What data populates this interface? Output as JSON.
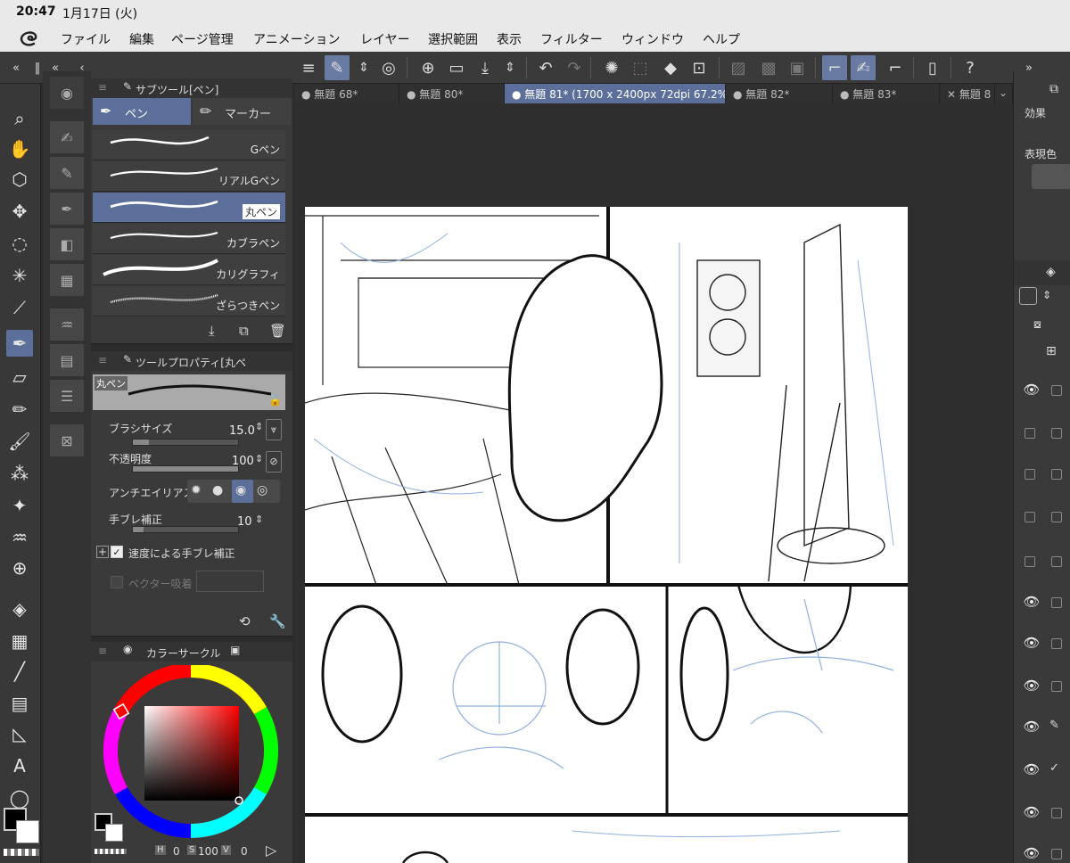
{
  "status": {
    "time": "20:47",
    "date": "1月17日 (火)"
  },
  "menu": [
    "ファイル",
    "編集",
    "ページ管理",
    "アニメーション",
    "レイヤー",
    "選択範囲",
    "表示",
    "フィルター",
    "ウィンドウ",
    "ヘルプ"
  ],
  "tabs": [
    {
      "label": "● 無題 68*"
    },
    {
      "label": "● 無題 80*"
    },
    {
      "label": "● 無題 81* (1700 x 2400px 72dpi 67.2%)"
    },
    {
      "label": "● 無題 82*"
    },
    {
      "label": "● 無題 83*"
    },
    {
      "label": "✕ 無題 8"
    }
  ],
  "subtool_panel": {
    "title": "サブツール[ペン]",
    "tabs": [
      "ペン",
      "マーカー"
    ],
    "brushes": [
      "Gペン",
      "リアルGペン",
      "丸ペン",
      "カブラペン",
      "カリグラフィ",
      "ざらつきペン"
    ],
    "selected_brush": "丸ペン"
  },
  "tool_property": {
    "title": "ツールプロパティ[丸ペ",
    "preview_label": "丸ペン",
    "brush_size_label": "ブラシサイズ",
    "brush_size_value": "15.0",
    "brush_size_level": 0.15,
    "opacity_label": "不透明度",
    "opacity_value": "100",
    "opacity_level": 1.0,
    "antialias_label": "アンチエイリアス",
    "stabilization_label": "手ブレ補正",
    "stabilization_value": "10",
    "stabilization_level": 0.1,
    "speed_stabilization_label": "速度による手ブレ補正",
    "vector_snap_label": "ベクター吸着"
  },
  "color_panel": {
    "title": "カラーサークル",
    "h_label": "H",
    "h_value": "0",
    "s_label": "S",
    "s_value": "100",
    "v_label": "V",
    "v_value": "0",
    "main_color": "#000000",
    "sub_color": "#ffffff"
  },
  "right_panel": {
    "effect_label": "効果",
    "expression_color_label": "表現色"
  },
  "colors": {
    "accent": "#5b6f9a",
    "panel": "#3a3a3a",
    "menubar": "#e9e9e9"
  }
}
